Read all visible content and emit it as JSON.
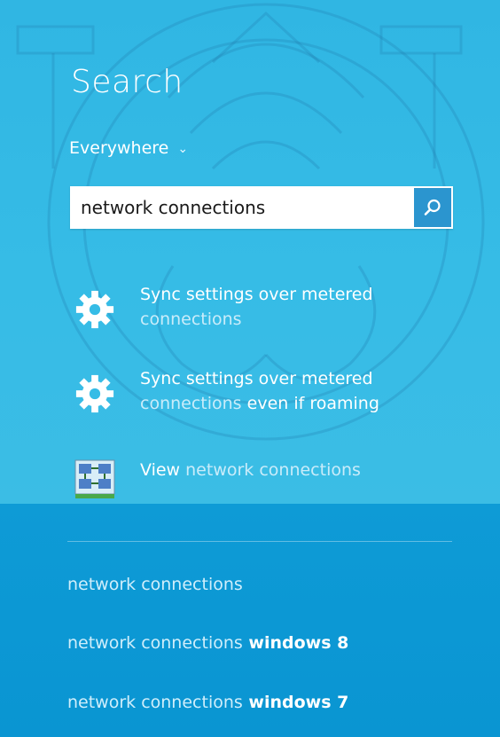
{
  "header": {
    "title": "Search",
    "scope": "Everywhere"
  },
  "search": {
    "query": "network connections"
  },
  "results": [
    {
      "icon": "gear-icon",
      "line1_main": "Sync settings over metered",
      "line2_dim": "connections",
      "line2_extra": ""
    },
    {
      "icon": "gear-icon",
      "line1_main": "Sync settings over metered",
      "line2_dim": "connections",
      "line2_extra": " even if roaming"
    },
    {
      "icon": "network-connections-icon",
      "prefix": "View",
      "dim": " network connections"
    }
  ],
  "suggestions": [
    {
      "dim": "network connections",
      "bold": ""
    },
    {
      "dim": "network connections",
      "bold": " windows 8"
    },
    {
      "dim": "network connections",
      "bold": " windows 7"
    }
  ],
  "colors": {
    "panel_top": "#36bce6",
    "panel_bottom": "#0e9bd6",
    "search_button": "#2b95cf",
    "text": "#ffffff",
    "dim_text": "#c9ecfa"
  }
}
